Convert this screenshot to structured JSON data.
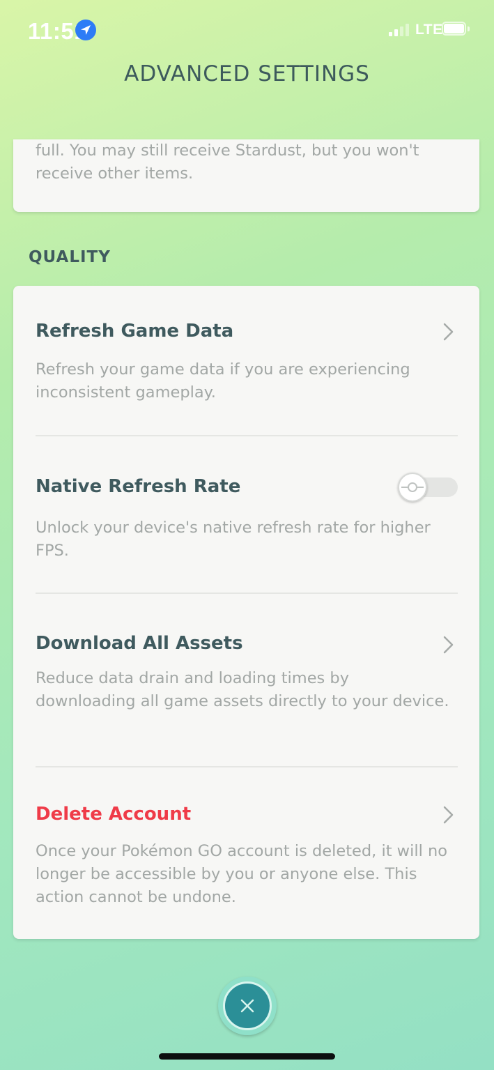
{
  "status_bar": {
    "time": "11:51",
    "network": "LTE",
    "location_icon": "location-arrow-icon",
    "signal_icon": "cellular-signal-icon",
    "battery_icon": "battery-icon"
  },
  "header": {
    "title": "ADVANCED SETTINGS"
  },
  "previous_card": {
    "description_tail": "full. You may still receive Stardust, but you won't receive other items."
  },
  "quality_section": {
    "label": "QUALITY",
    "items": [
      {
        "title": "Refresh Game Data",
        "description": "Refresh your game data if you are experiencing inconsistent gameplay.",
        "control": "chevron-right-icon"
      },
      {
        "title": "Native Refresh Rate",
        "description": "Unlock your device's native refresh rate for higher FPS.",
        "control": "toggle",
        "toggle_on": false
      },
      {
        "title": "Download All Assets",
        "description": "Reduce data drain and loading times by downloading all game assets directly to your device.",
        "control": "chevron-right-icon"
      },
      {
        "title": "Delete Account",
        "description": "Once your Pokémon GO account is deleted, it will no longer be accessible by you or anyone else. This action cannot be undone.",
        "control": "chevron-right-icon"
      }
    ]
  },
  "footer": {
    "close_icon": "close-icon"
  },
  "colors": {
    "title_text": "#3f5a5e",
    "description_text": "#a2a7a5",
    "danger": "#ef3b48",
    "close_button": "#2b8f97"
  }
}
